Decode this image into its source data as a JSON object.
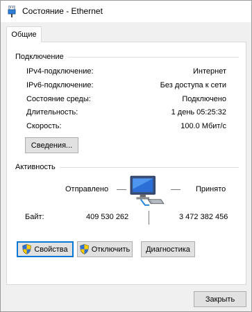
{
  "window": {
    "title": "Состояние - Ethernet"
  },
  "tabs": [
    {
      "label": "Общие"
    }
  ],
  "connection": {
    "group_title": "Подключение",
    "rows": [
      {
        "label": "IPv4-подключение:",
        "value": "Интернет"
      },
      {
        "label": "IPv6-подключение:",
        "value": "Без доступа к сети"
      },
      {
        "label": "Состояние среды:",
        "value": "Подключено"
      },
      {
        "label": "Длительность:",
        "value": "1 день 05:25:32"
      },
      {
        "label": "Скорость:",
        "value": "100.0 Мбит/с"
      }
    ],
    "details_button": "Сведения..."
  },
  "activity": {
    "group_title": "Активность",
    "sent_label": "Отправлено",
    "received_label": "Принято",
    "bytes_label": "Байт:",
    "bytes_sent": "409 530 262",
    "bytes_received": "3 472 382 456"
  },
  "actions": {
    "properties": "Свойства",
    "disable": "Отключить",
    "diagnose": "Диагностика"
  },
  "footer": {
    "close": "Закрыть"
  },
  "icons": {
    "title": "ethernet-plug-icon",
    "shield": "uac-shield-icon",
    "activity": "network-computer-icon"
  },
  "colors": {
    "focus": "#0078d7",
    "button": "#e1e1e1"
  }
}
